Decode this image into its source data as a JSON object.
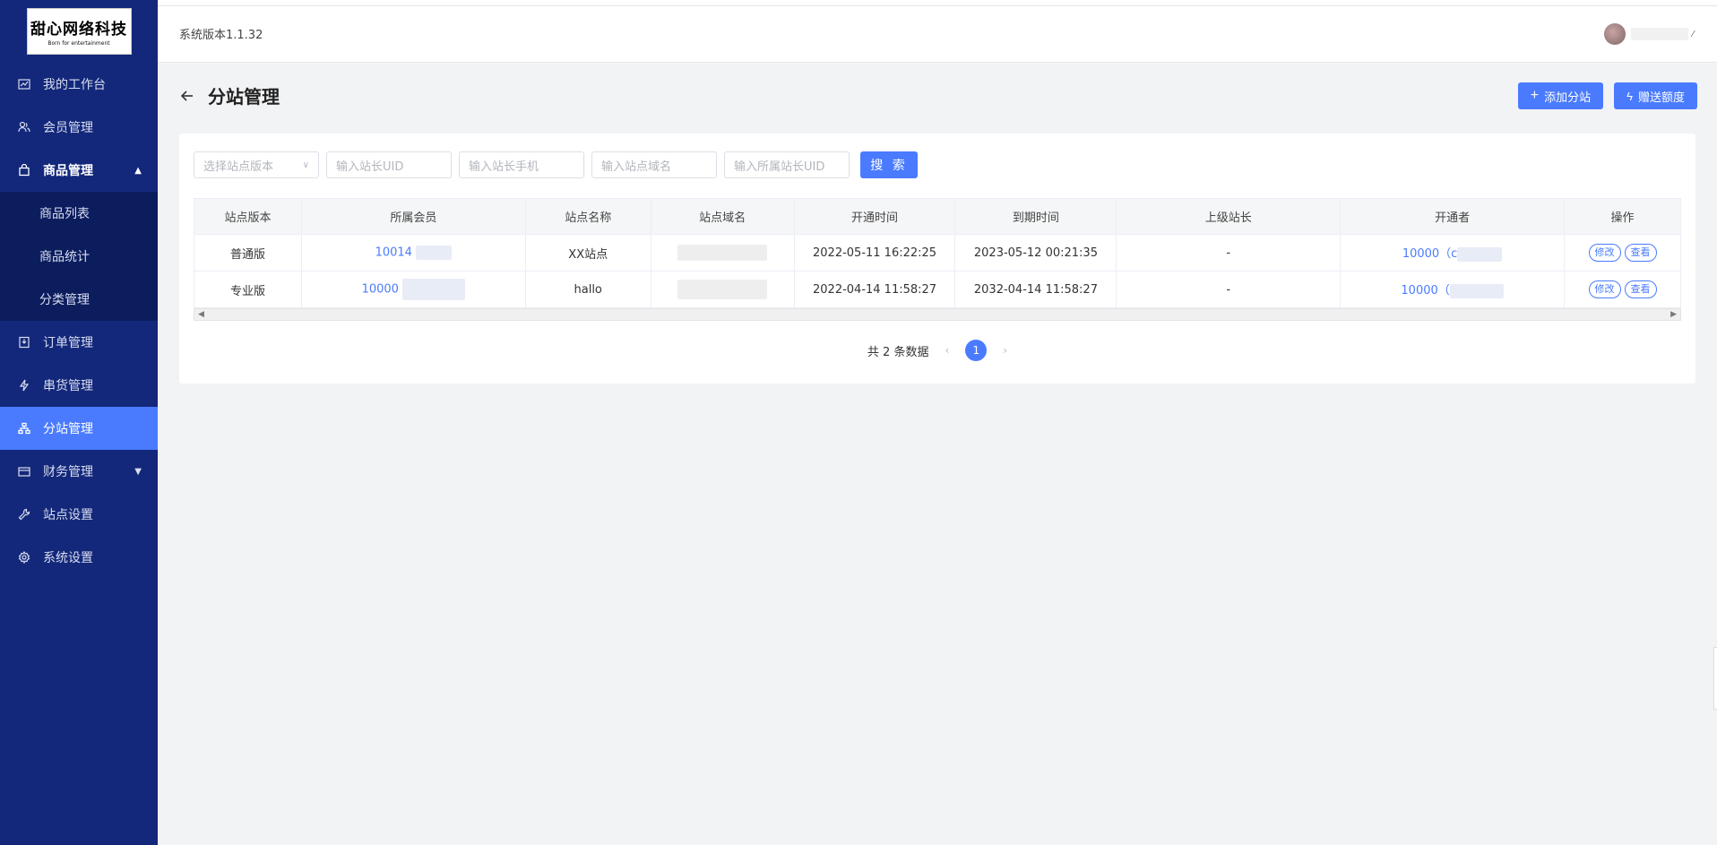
{
  "sidebar": {
    "logo_title": "甜心网络科技",
    "logo_sub": "Born for entertainment",
    "items": [
      {
        "label": "我的工作台",
        "icon": "chart-icon"
      },
      {
        "label": "会员管理",
        "icon": "users-icon"
      },
      {
        "label": "商品管理",
        "icon": "bag-icon",
        "expanded": true
      },
      {
        "label": "订单管理",
        "icon": "order-icon"
      },
      {
        "label": "串货管理",
        "icon": "bolt-icon"
      },
      {
        "label": "分站管理",
        "icon": "sitemap-icon",
        "active": true
      },
      {
        "label": "财务管理",
        "icon": "wallet-icon"
      },
      {
        "label": "站点设置",
        "icon": "wrench-icon"
      },
      {
        "label": "系统设置",
        "icon": "gear-icon"
      }
    ],
    "sub_items": [
      "商品列表",
      "商品统计",
      "分类管理"
    ]
  },
  "header": {
    "version": "系统版本1.1.32"
  },
  "page": {
    "title": "分站管理",
    "add_button": "添加分站",
    "gift_button": "赠送额度"
  },
  "filters": {
    "version_placeholder": "选择站点版本",
    "uid_placeholder": "输入站长UID",
    "phone_placeholder": "输入站长手机",
    "domain_placeholder": "输入站点域名",
    "parent_uid_placeholder": "输入所属站长UID",
    "search_label": "搜 索"
  },
  "table": {
    "columns": [
      "站点版本",
      "所属会员",
      "站点名称",
      "站点域名",
      "开通时间",
      "到期时间",
      "上级站长",
      "开通者",
      "操作"
    ],
    "rows": [
      {
        "version": "普通版",
        "member": "10014",
        "name": "XX站点",
        "open_time": "2022-05-11 16:22:25",
        "expire_time": "2023-05-12 00:21:35",
        "parent": "-",
        "opener": "10000（c",
        "edit": "修改",
        "view": "查看"
      },
      {
        "version": "专业版",
        "member": "10000",
        "name": "hallo",
        "open_time": "2022-04-14 11:58:27",
        "expire_time": "2032-04-14 11:58:27",
        "parent": "-",
        "opener": "10000（",
        "edit": "修改",
        "view": "查看"
      }
    ]
  },
  "pagination": {
    "total_text": "共 2 条数据",
    "current_page": "1"
  },
  "colors": {
    "sidebar_bg": "#13287a",
    "accent": "#4a7bff",
    "page_bg": "#f2f3f5"
  }
}
